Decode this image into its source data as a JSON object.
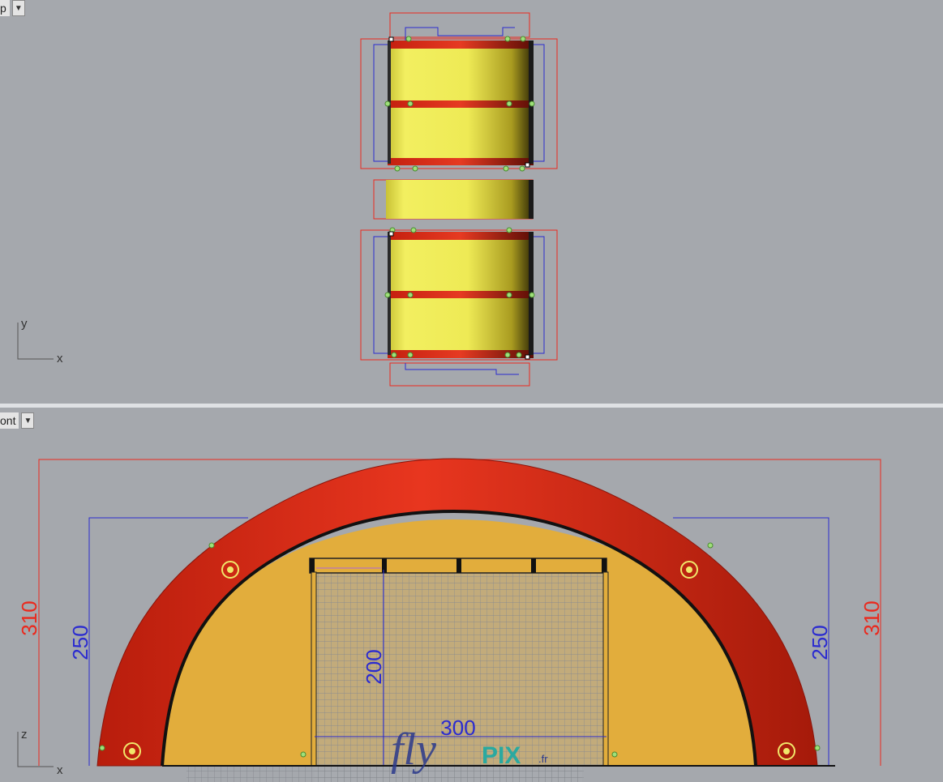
{
  "viewports": {
    "top": {
      "label": "p",
      "dropdown_icon": "chevron-down-icon",
      "axes": {
        "vertical": "y",
        "horizontal": "x"
      }
    },
    "front": {
      "label": "ont",
      "dropdown_icon": "chevron-down-icon",
      "axes": {
        "vertical": "z",
        "horizontal": "x"
      }
    }
  },
  "dimensions": {
    "outer_height_left": "310",
    "outer_height_right": "310",
    "inner_height_left": "250",
    "inner_height_right": "250",
    "door_height": "200",
    "door_width": "300"
  },
  "watermark": {
    "brand_script": "fly",
    "brand_pix": "PIX",
    "tld": ".fr"
  },
  "colors": {
    "background": "#a5a8ad",
    "arch": "#e0331f",
    "fill": "#e2ad3c",
    "cylinder": "#eeec55",
    "dim_red": "#ea2a1e",
    "dim_blue": "#2b2bd0"
  }
}
